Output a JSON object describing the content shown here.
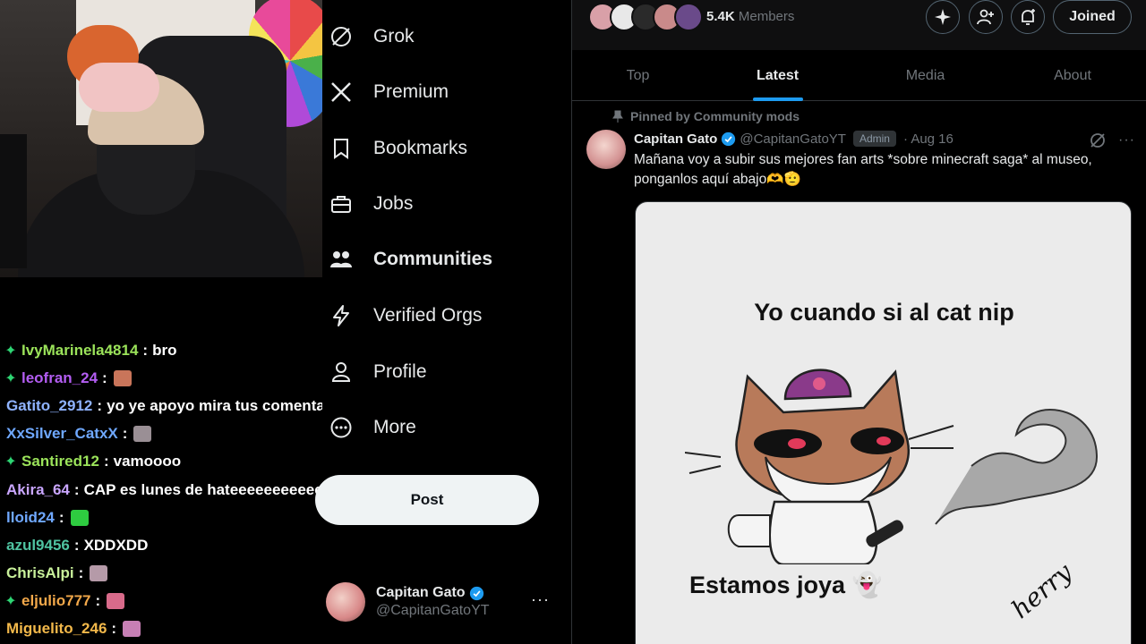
{
  "chat": [
    {
      "badge": true,
      "user": "IvyMarinela4814",
      "color": "#9be35a",
      "msg": "bro",
      "emote": null
    },
    {
      "badge": true,
      "user": "leofran_24",
      "color": "#b35df2",
      "msg": "",
      "emote": "#c9755a"
    },
    {
      "badge": false,
      "user": "Gatito_2912",
      "color": "#8fb3ff",
      "msg": "yo ye apoyo mira tus comentarios",
      "emote": null
    },
    {
      "badge": false,
      "user": "XxSilver_CatxX",
      "color": "#6fa8ff",
      "msg": "",
      "emote": "#9a8f95"
    },
    {
      "badge": true,
      "user": "Santired12",
      "color": "#9be35a",
      "msg": "vamoooo",
      "emote": null
    },
    {
      "badge": false,
      "user": "Akira_64",
      "color": "#c9a6ff",
      "msg": "CAP es lunes de hateeeeeeeeeeeeeeee",
      "emote": null
    },
    {
      "badge": false,
      "user": "lloid24",
      "color": "#6fa8ff",
      "msg": "",
      "emote": "#2ecc40"
    },
    {
      "badge": false,
      "user": "azul9456",
      "color": "#4fc3a1",
      "msg": "XDDXDD",
      "emote": null
    },
    {
      "badge": false,
      "user": "ChrisAlpi",
      "color": "#c8f09a",
      "msg": "",
      "emote": "#b59aa8"
    },
    {
      "badge": true,
      "user": "eljulio777",
      "color": "#f2a84a",
      "msg": "",
      "emote": "#d86a8a"
    },
    {
      "badge": false,
      "user": "Miguelito_246",
      "color": "#f2b84a",
      "msg": "",
      "emote": "#c77fb5"
    }
  ],
  "nav": {
    "items": [
      {
        "label": "Grok",
        "icon": "grok-icon"
      },
      {
        "label": "Premium",
        "icon": "x-logo-icon"
      },
      {
        "label": "Bookmarks",
        "icon": "bookmark-icon"
      },
      {
        "label": "Jobs",
        "icon": "briefcase-icon"
      },
      {
        "label": "Communities",
        "icon": "communities-icon",
        "active": true
      },
      {
        "label": "Verified Orgs",
        "icon": "lightning-icon"
      },
      {
        "label": "Profile",
        "icon": "person-icon"
      },
      {
        "label": "More",
        "icon": "more-circle-icon"
      }
    ],
    "post_label": "Post"
  },
  "account": {
    "display_name": "Capitan Gato",
    "handle": "@CapitanGatoYT",
    "more": "···"
  },
  "community": {
    "members_count": "5.4K",
    "members_label": "Members",
    "joined_label": "Joined",
    "tabs": [
      "Top",
      "Latest",
      "Media",
      "About"
    ],
    "active_tab": "Latest"
  },
  "post": {
    "pinned_label": "Pinned by Community mods",
    "author": "Capitan Gato",
    "handle": "@CapitanGatoYT",
    "role": "Admin",
    "date": "· Aug 16",
    "more": "···",
    "text": "Mañana voy a subir sus mejores fan arts *sobre minecraft saga* al museo, ponganlos aquí abajo🫶🫡",
    "image_title": "Yo cuando si al cat nip",
    "image_caption": "Estamos joya 👻",
    "image_signature": "herry"
  },
  "colors": {
    "accent": "#1d9bf0",
    "verified": "#1d9bf0",
    "chat_badge": "#2ed573"
  }
}
